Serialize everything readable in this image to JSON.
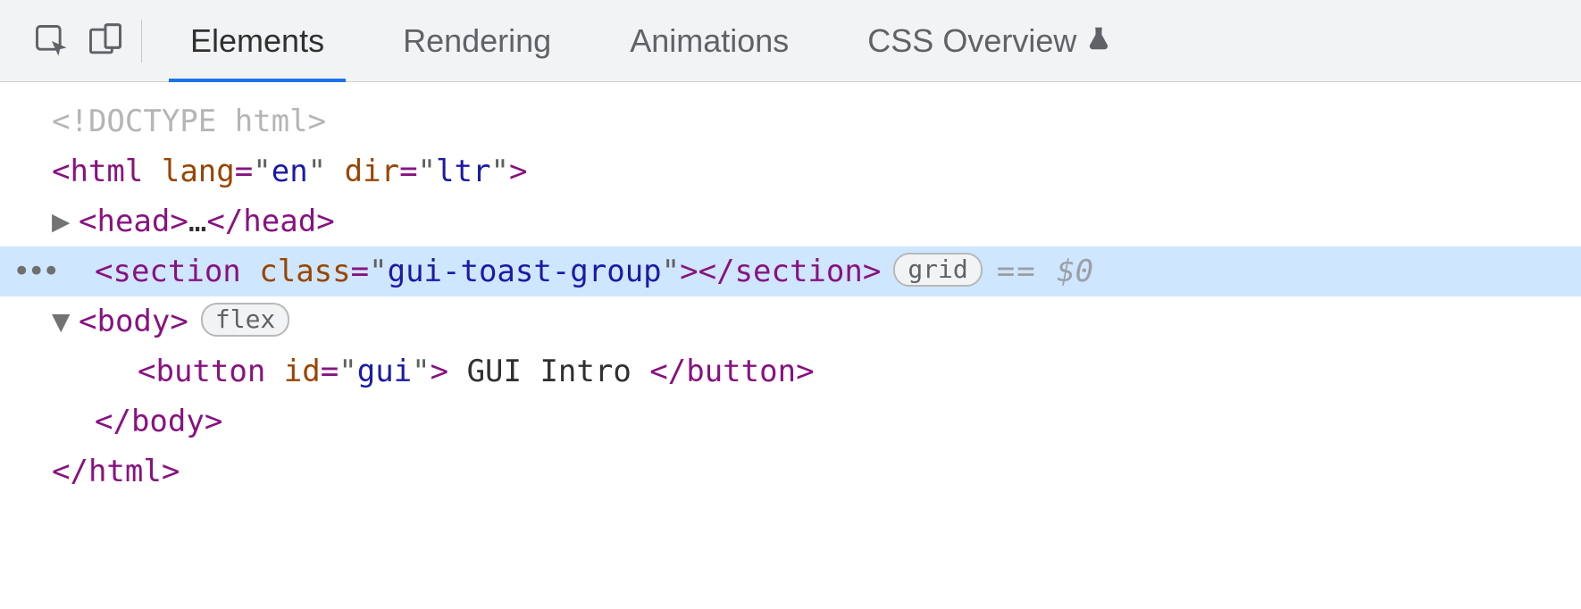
{
  "tabs": {
    "elements": "Elements",
    "rendering": "Rendering",
    "animations": "Animations",
    "css_overview": "CSS Overview"
  },
  "dom": {
    "doctype": "<!DOCTYPE html>",
    "html_open": {
      "tag": "html",
      "attrs": [
        {
          "name": "lang",
          "value": "en"
        },
        {
          "name": "dir",
          "value": "ltr"
        }
      ]
    },
    "head_collapsed": {
      "tag": "head",
      "ellipsis": "…"
    },
    "section": {
      "tag": "section",
      "attrs": [
        {
          "name": "class",
          "value": "gui-toast-group"
        }
      ],
      "badge": "grid"
    },
    "selected_suffix": "$0",
    "body_open": {
      "tag": "body",
      "badge": "flex"
    },
    "button": {
      "tag": "button",
      "attrs": [
        {
          "name": "id",
          "value": "gui"
        }
      ],
      "text": " GUI Intro "
    },
    "body_close": "body",
    "html_close": "html"
  }
}
